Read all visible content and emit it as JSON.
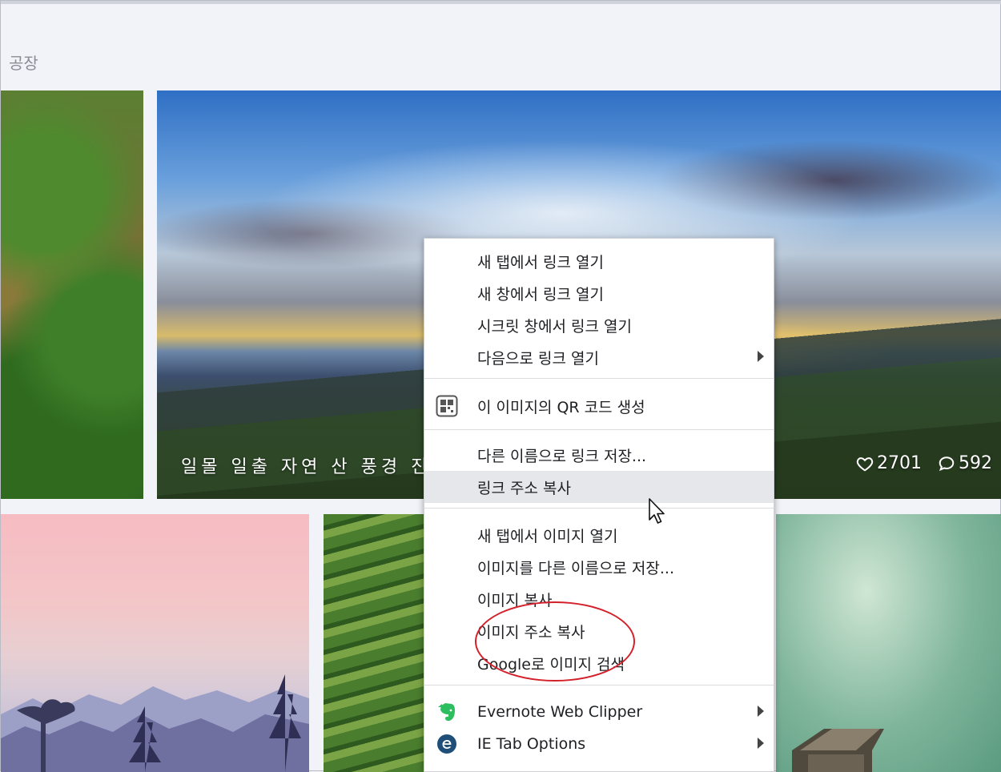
{
  "breadcrumb": "공장",
  "featured": {
    "caption": "일몰 일출 자연 산 풍경 진",
    "likes": "2701",
    "comments": "592"
  },
  "context_menu": {
    "items": [
      {
        "label": "새 탭에서 링크 열기"
      },
      {
        "label": "새 창에서 링크 열기"
      },
      {
        "label": "시크릿 창에서 링크 열기"
      },
      {
        "label": "다음으로 링크 열기",
        "submenu": true
      },
      {
        "label": "이 이미지의 QR 코드 생성",
        "icon": "qr-code-icon"
      },
      {
        "label": "다른 이름으로 링크 저장..."
      },
      {
        "label": "링크 주소 복사",
        "hovered": true
      },
      {
        "label": "새 탭에서 이미지 열기"
      },
      {
        "label": "이미지를 다른 이름으로 저장..."
      },
      {
        "label": "이미지 복사"
      },
      {
        "label": "이미지 주소 복사",
        "highlighted": true
      },
      {
        "label": "Google로 이미지 검색"
      },
      {
        "label": "Evernote Web Clipper",
        "icon": "evernote-icon",
        "submenu": true
      },
      {
        "label": "IE Tab Options",
        "icon": "ie-tab-icon",
        "submenu": true
      }
    ]
  },
  "colors": {
    "annotation": "#d4202a",
    "evernote": "#2dbe60",
    "ie_tab": "#1f4e79",
    "hover": "#e6e7ea"
  }
}
